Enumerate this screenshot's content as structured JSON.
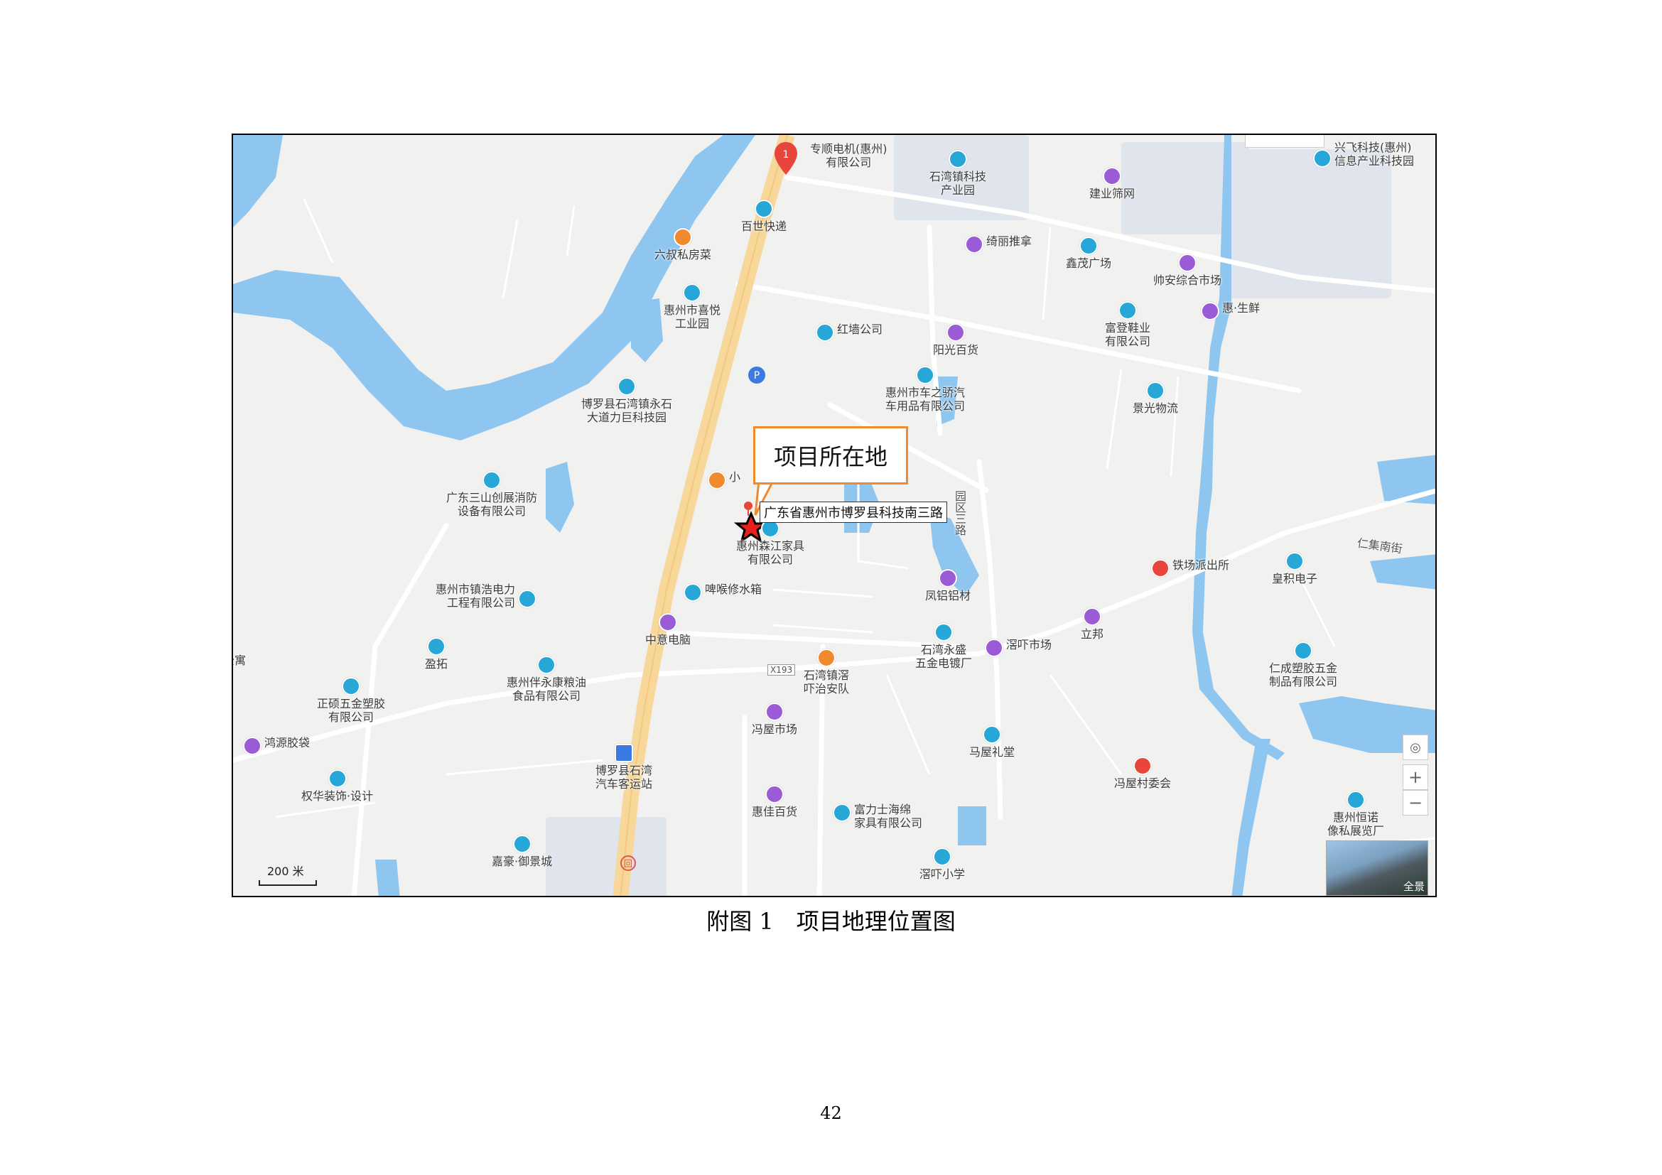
{
  "map": {
    "callout_label": "项目所在地",
    "address_label": "广东省惠州市博罗县科技南三路",
    "scale_label": "200 米",
    "streetview_label": "全景",
    "road_labels": [
      "X193",
      "园区三路",
      "仁集南街"
    ],
    "controls": {
      "locate": "◎",
      "zoom_in": "+",
      "zoom_out": "−"
    },
    "pois": [
      {
        "label": "专顺电机(惠州)\n有限公司",
        "color": "red"
      },
      {
        "label": "石湾镇科技\n产业园",
        "color": "blue"
      },
      {
        "label": "建业筛网",
        "color": "purple"
      },
      {
        "label": "兴飞科技(惠州)\n信息产业科技园",
        "color": "blue"
      },
      {
        "label": "百世快递",
        "color": "blue"
      },
      {
        "label": "六叔私房菜",
        "color": "orange"
      },
      {
        "label": "绮丽推拿",
        "color": "purple"
      },
      {
        "label": "鑫茂广场",
        "color": "blue"
      },
      {
        "label": "帅安综合市场",
        "color": "purple"
      },
      {
        "label": "惠州市喜悦\n工业园",
        "color": "blue"
      },
      {
        "label": "惠·生鲜",
        "color": "purple"
      },
      {
        "label": "红墙公司",
        "color": "blue"
      },
      {
        "label": "阳光百货",
        "color": "purple"
      },
      {
        "label": "富登鞋业\n有限公司",
        "color": "blue"
      },
      {
        "label": "博罗县石湾镇永石\n大道力巨科技园",
        "color": "blue"
      },
      {
        "label": "惠州市车之骄汽\n车用品有限公司",
        "color": "blue"
      },
      {
        "label": "景光物流",
        "color": "blue"
      },
      {
        "label": "广东三山创展消防\n设备有限公司",
        "color": "blue"
      },
      {
        "label": "小",
        "color": "orange"
      },
      {
        "label": "惠州森江家具\n有限公司",
        "color": "blue"
      },
      {
        "label": "铁场派出所",
        "color": "red"
      },
      {
        "label": "皇积电子",
        "color": "blue"
      },
      {
        "label": "凤铝铝材",
        "color": "purple"
      },
      {
        "label": "惠州市镇浩电力\n工程有限公司",
        "color": "blue"
      },
      {
        "label": "啤喉修水箱",
        "color": "blue"
      },
      {
        "label": "中意电脑",
        "color": "purple"
      },
      {
        "label": "立邦",
        "color": "purple"
      },
      {
        "label": "盈拓",
        "color": "blue"
      },
      {
        "label": "惠州伴永康粮油\n食品有限公司",
        "color": "blue"
      },
      {
        "label": "石湾镇滘\n吓治安队",
        "color": "orange"
      },
      {
        "label": "石湾永盛\n五金电镀厂",
        "color": "blue"
      },
      {
        "label": "滘吓市场",
        "color": "purple"
      },
      {
        "label": "仁成塑胶五金\n制品有限公司",
        "color": "blue"
      },
      {
        "label": "正硕五金塑胶\n有限公司",
        "color": "blue"
      },
      {
        "label": "冯屋市场",
        "color": "purple"
      },
      {
        "label": "鸿源胶袋",
        "color": "purple"
      },
      {
        "label": "马屋礼堂",
        "color": "blue"
      },
      {
        "label": "博罗县石湾\n汽车客运站",
        "color": "pblue"
      },
      {
        "label": "冯屋村委会",
        "color": "red"
      },
      {
        "label": "权华装饰·设计",
        "color": "blue"
      },
      {
        "label": "惠佳百货",
        "color": "purple"
      },
      {
        "label": "富力士海绵\n家具有限公司",
        "color": "blue"
      },
      {
        "label": "惠州恒诺\n像私展览厂",
        "color": "blue"
      },
      {
        "label": "嘉豪·御景城",
        "color": "blue"
      },
      {
        "label": "滘吓小学",
        "color": "blue"
      },
      {
        "label": "公寓",
        "color": "blue"
      }
    ]
  },
  "caption": "附图 1　项目地理位置图",
  "page_number": "42"
}
